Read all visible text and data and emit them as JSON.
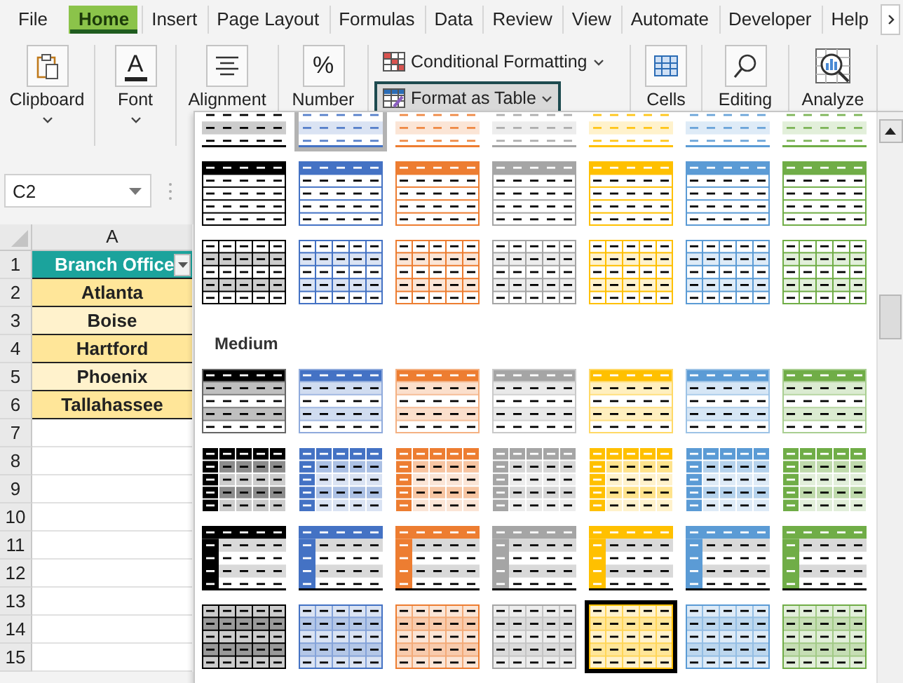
{
  "ribbon": {
    "tabs": [
      {
        "label": "File",
        "selected": false
      },
      {
        "label": "Home",
        "selected": true
      },
      {
        "label": "Insert",
        "selected": false
      },
      {
        "label": "Page Layout",
        "selected": false
      },
      {
        "label": "Formulas",
        "selected": false
      },
      {
        "label": "Data",
        "selected": false
      },
      {
        "label": "Review",
        "selected": false
      },
      {
        "label": "View",
        "selected": false
      },
      {
        "label": "Automate",
        "selected": false
      },
      {
        "label": "Developer",
        "selected": false
      },
      {
        "label": "Help",
        "selected": false
      }
    ],
    "groups": [
      {
        "kind": "big",
        "label": "Clipboard",
        "has_menu": true
      },
      {
        "kind": "big",
        "label": "Font",
        "glyph": "A",
        "has_menu": true
      },
      {
        "kind": "big",
        "label": "Alignment",
        "has_menu": false
      },
      {
        "kind": "big",
        "label": "Number",
        "glyph": "%",
        "has_menu": false
      },
      {
        "kind": "styles",
        "buttons": [
          {
            "label": "Conditional Formatting",
            "active": false
          },
          {
            "label": "Format as Table",
            "active": true
          }
        ]
      },
      {
        "kind": "big",
        "label": "Cells",
        "has_menu": false
      },
      {
        "kind": "big",
        "label": "Editing",
        "has_menu": false
      },
      {
        "kind": "big",
        "label": "Analyze",
        "has_menu": false
      }
    ]
  },
  "sheet": {
    "name_box": "C2",
    "column_header": "A",
    "row_numbers": [
      "1",
      "2",
      "3",
      "4",
      "5",
      "6",
      "7",
      "8",
      "9",
      "10",
      "11",
      "12",
      "13",
      "14",
      "15"
    ],
    "table": {
      "header": "Branch Office",
      "filter_button": true,
      "rows": [
        {
          "value": "Atlanta",
          "shaded": true
        },
        {
          "value": "Boise",
          "shaded": false
        },
        {
          "value": "Hartford",
          "shaded": true
        },
        {
          "value": "Phoenix",
          "shaded": false
        },
        {
          "value": "Tallahassee",
          "shaded": true
        }
      ]
    }
  },
  "gallery": {
    "light_rows": [
      {
        "kind": "light-banded",
        "styles": [
          {
            "color": "#000000",
            "selected": false,
            "highlighted": false
          },
          {
            "color": "#4472c4",
            "selected": false,
            "highlighted": true
          },
          {
            "color": "#ed7d31",
            "selected": false,
            "highlighted": false
          },
          {
            "color": "#a5a5a5",
            "selected": false,
            "highlighted": false
          },
          {
            "color": "#ffc000",
            "selected": false,
            "highlighted": false
          },
          {
            "color": "#5b9bd5",
            "selected": false,
            "highlighted": false
          },
          {
            "color": "#70ad47",
            "selected": false,
            "highlighted": false
          }
        ]
      },
      {
        "kind": "light-header",
        "styles": [
          {
            "color": "#000000",
            "selected": false,
            "highlighted": false
          },
          {
            "color": "#4472c4",
            "selected": false,
            "highlighted": false
          },
          {
            "color": "#ed7d31",
            "selected": false,
            "highlighted": false
          },
          {
            "color": "#a5a5a5",
            "selected": false,
            "highlighted": false
          },
          {
            "color": "#ffc000",
            "selected": false,
            "highlighted": false
          },
          {
            "color": "#5b9bd5",
            "selected": false,
            "highlighted": false
          },
          {
            "color": "#70ad47",
            "selected": false,
            "highlighted": false
          }
        ]
      },
      {
        "kind": "light-grid",
        "styles": [
          {
            "color": "#000000",
            "selected": false,
            "highlighted": false
          },
          {
            "color": "#4472c4",
            "selected": false,
            "highlighted": false
          },
          {
            "color": "#ed7d31",
            "selected": false,
            "highlighted": false
          },
          {
            "color": "#a5a5a5",
            "selected": false,
            "highlighted": false
          },
          {
            "color": "#ffc000",
            "selected": false,
            "highlighted": false
          },
          {
            "color": "#5b9bd5",
            "selected": false,
            "highlighted": false
          },
          {
            "color": "#70ad47",
            "selected": false,
            "highlighted": false
          }
        ]
      }
    ],
    "medium_heading": "Medium",
    "medium_rows": [
      {
        "kind": "medium-banded",
        "styles": [
          {
            "color": "#000000",
            "selected": false,
            "highlighted": false
          },
          {
            "color": "#4472c4",
            "selected": false,
            "highlighted": false
          },
          {
            "color": "#ed7d31",
            "selected": false,
            "highlighted": false
          },
          {
            "color": "#a5a5a5",
            "selected": false,
            "highlighted": false
          },
          {
            "color": "#ffc000",
            "selected": false,
            "highlighted": false
          },
          {
            "color": "#5b9bd5",
            "selected": false,
            "highlighted": false
          },
          {
            "color": "#70ad47",
            "selected": false,
            "highlighted": false
          }
        ]
      },
      {
        "kind": "medium-first-column",
        "styles": [
          {
            "color": "#000000",
            "selected": false,
            "highlighted": false
          },
          {
            "color": "#4472c4",
            "selected": false,
            "highlighted": false
          },
          {
            "color": "#ed7d31",
            "selected": false,
            "highlighted": false
          },
          {
            "color": "#a5a5a5",
            "selected": false,
            "highlighted": false
          },
          {
            "color": "#ffc000",
            "selected": false,
            "highlighted": false
          },
          {
            "color": "#5b9bd5",
            "selected": false,
            "highlighted": false
          },
          {
            "color": "#70ad47",
            "selected": false,
            "highlighted": false
          }
        ]
      },
      {
        "kind": "medium-header-column",
        "styles": [
          {
            "color": "#000000",
            "selected": false,
            "highlighted": false
          },
          {
            "color": "#4472c4",
            "selected": false,
            "highlighted": false
          },
          {
            "color": "#ed7d31",
            "selected": false,
            "highlighted": false
          },
          {
            "color": "#a5a5a5",
            "selected": false,
            "highlighted": false
          },
          {
            "color": "#ffc000",
            "selected": false,
            "highlighted": false
          },
          {
            "color": "#5b9bd5",
            "selected": false,
            "highlighted": false
          },
          {
            "color": "#70ad47",
            "selected": false,
            "highlighted": false
          }
        ]
      },
      {
        "kind": "medium-grid",
        "styles": [
          {
            "color": "#000000",
            "selected": false,
            "highlighted": false
          },
          {
            "color": "#4472c4",
            "selected": false,
            "highlighted": false
          },
          {
            "color": "#ed7d31",
            "selected": false,
            "highlighted": false
          },
          {
            "color": "#a5a5a5",
            "selected": false,
            "highlighted": false
          },
          {
            "color": "#ffc000",
            "selected": true,
            "highlighted": false
          },
          {
            "color": "#5b9bd5",
            "selected": false,
            "highlighted": false
          },
          {
            "color": "#70ad47",
            "selected": false,
            "highlighted": false
          }
        ]
      }
    ]
  }
}
